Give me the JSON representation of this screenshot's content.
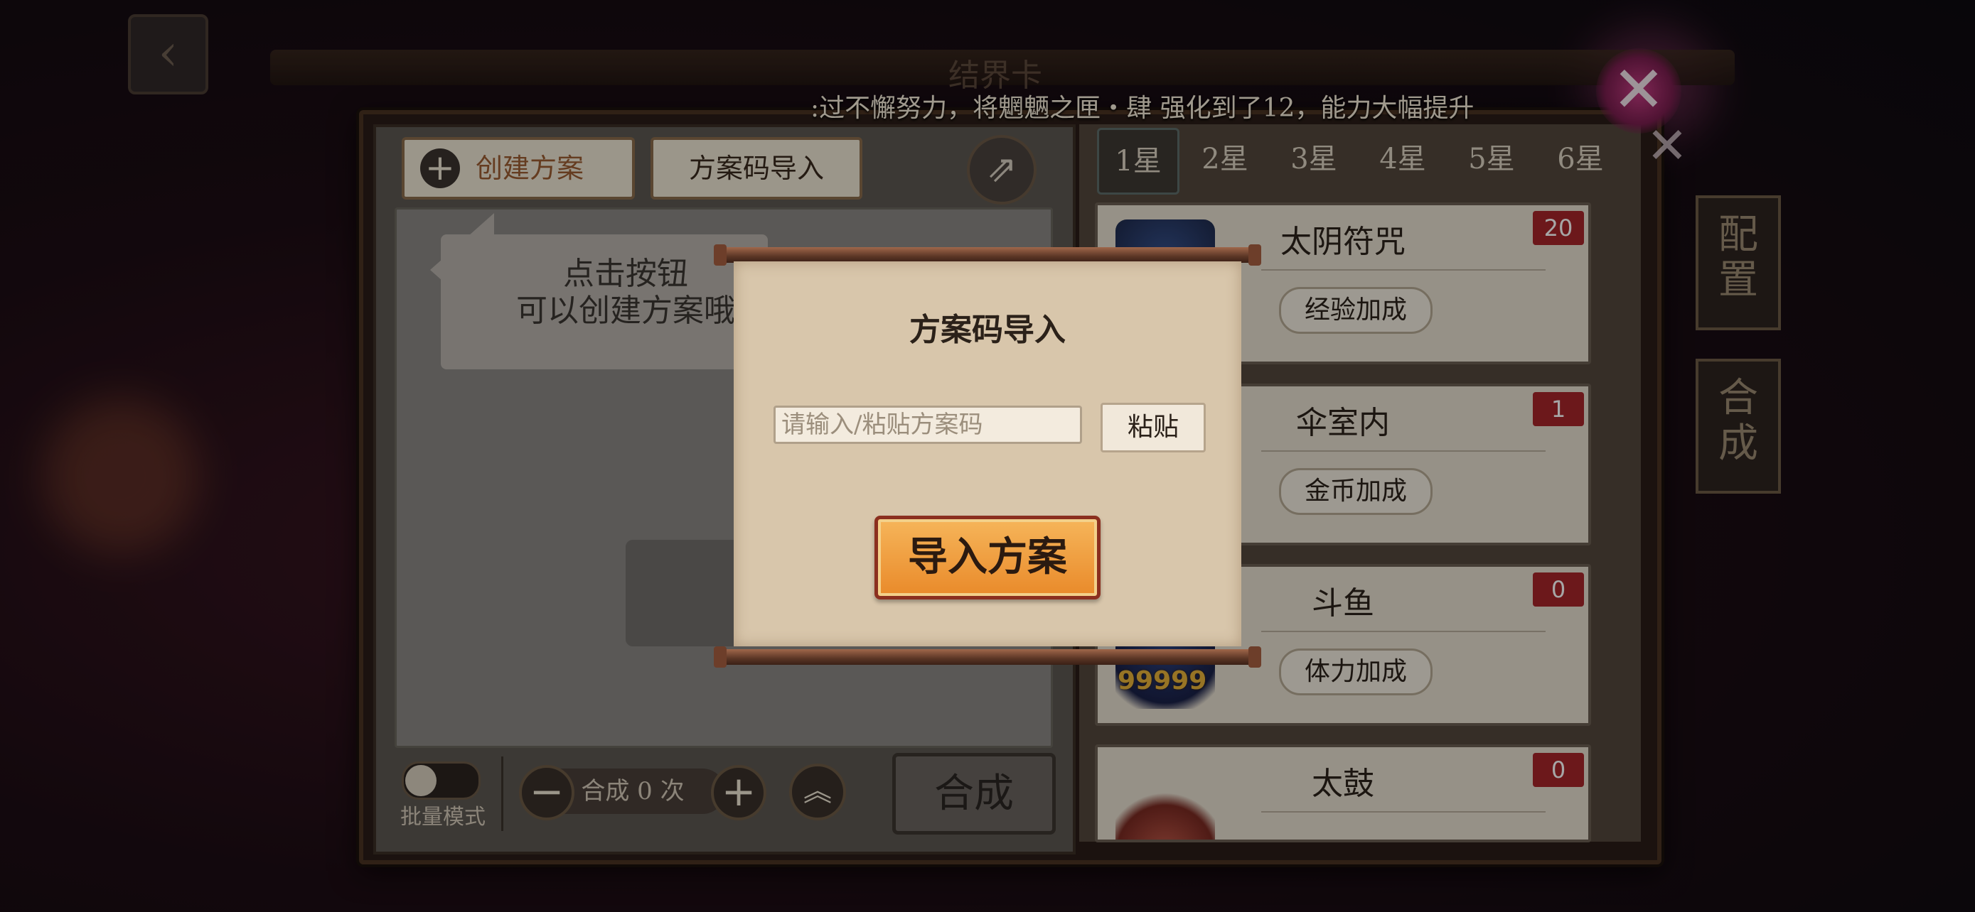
{
  "marquee_text": ":过不懈努力，将魍魉之匣・肆 强化到了12，能力大幅提升",
  "header": {
    "title_partial": "结界卡"
  },
  "left_panel": {
    "create_button": "创建方案",
    "code_import_button": "方案码导入",
    "hint_line1": "点击按钮",
    "hint_line2": "可以创建方案哦",
    "batch_mode_label": "批量模式",
    "synth_count_text": "合成 0 次",
    "synth_button": "合成"
  },
  "star_tabs": [
    "1星",
    "2星",
    "3星",
    "4星",
    "5星",
    "6星"
  ],
  "active_star_tab": "1星",
  "cards": [
    {
      "name": "太阴符咒",
      "bonus": "经验加成",
      "count": "20"
    },
    {
      "name": "伞室内",
      "bonus": "金币加成",
      "count": "1"
    },
    {
      "name": "斗鱼",
      "bonus": "体力加成",
      "count": "0",
      "overlay_number": "99999"
    },
    {
      "name": "太鼓",
      "bonus": "",
      "count": "0"
    }
  ],
  "side_buttons": {
    "config": "配置",
    "synth": "合成"
  },
  "modal": {
    "title": "方案码导入",
    "input_placeholder": "请输入/粘贴方案码",
    "input_value": "",
    "paste_button": "粘贴",
    "import_button": "导入方案"
  },
  "colors": {
    "badge_red": "#a6262a",
    "import_button_orange": "#e98a2a",
    "parchment": "#d8c6ab"
  }
}
